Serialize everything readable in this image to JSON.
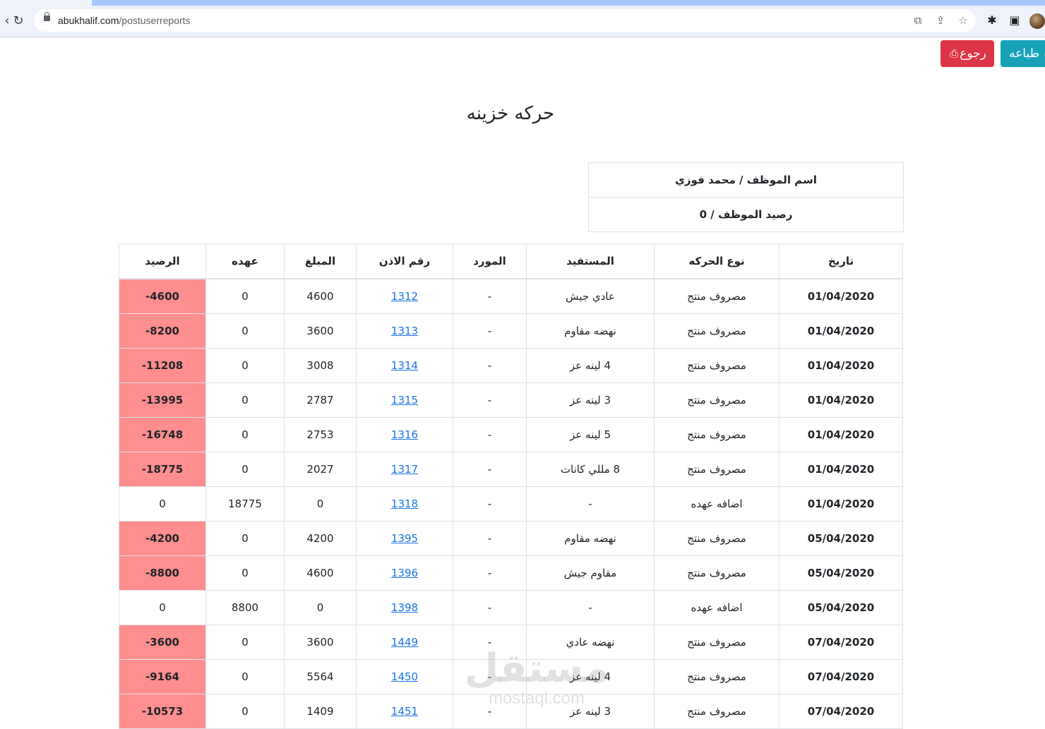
{
  "browser": {
    "url_host": "abukhalif.com",
    "url_path": "/postuserreports"
  },
  "actions": {
    "back_label": "رجوع",
    "print_label": "طباعه"
  },
  "page": {
    "title": "حركه خزينه"
  },
  "employee": {
    "name_line": "اسم الموظف / محمد فوزي",
    "balance_line": "رصيد الموظف / 0"
  },
  "table": {
    "headers": [
      "تاريخ",
      "نوع الحركه",
      "المستفيد",
      "المورد",
      "رقم الاذن",
      "المبلغ",
      "عهده",
      "الرصيد"
    ],
    "rows": [
      {
        "date": "01/04/2020",
        "type": "مصروف منتج",
        "beneficiary": "عادي جيش",
        "supplier": "-",
        "permit_no": "1312",
        "amount": "4600",
        "custody": "0",
        "balance": "-4600",
        "negative": true
      },
      {
        "date": "01/04/2020",
        "type": "مصروف منتج",
        "beneficiary": "نهضه مقاوم",
        "supplier": "-",
        "permit_no": "1313",
        "amount": "3600",
        "custody": "0",
        "balance": "-8200",
        "negative": true
      },
      {
        "date": "01/04/2020",
        "type": "مصروف منتج",
        "beneficiary": "4 لينه عز",
        "supplier": "-",
        "permit_no": "1314",
        "amount": "3008",
        "custody": "0",
        "balance": "-11208",
        "negative": true
      },
      {
        "date": "01/04/2020",
        "type": "مصروف منتج",
        "beneficiary": "3 لينه عز",
        "supplier": "-",
        "permit_no": "1315",
        "amount": "2787",
        "custody": "0",
        "balance": "-13995",
        "negative": true
      },
      {
        "date": "01/04/2020",
        "type": "مصروف منتج",
        "beneficiary": "5 لينه عز",
        "supplier": "-",
        "permit_no": "1316",
        "amount": "2753",
        "custody": "0",
        "balance": "-16748",
        "negative": true
      },
      {
        "date": "01/04/2020",
        "type": "مصروف منتج",
        "beneficiary": "8 مللي كانات",
        "supplier": "-",
        "permit_no": "1317",
        "amount": "2027",
        "custody": "0",
        "balance": "-18775",
        "negative": true
      },
      {
        "date": "01/04/2020",
        "type": "اضافه عهده",
        "beneficiary": "-",
        "supplier": "-",
        "permit_no": "1318",
        "amount": "0",
        "custody": "18775",
        "balance": "0",
        "negative": false
      },
      {
        "date": "05/04/2020",
        "type": "مصروف منتج",
        "beneficiary": "نهضه مقاوم",
        "supplier": "-",
        "permit_no": "1395",
        "amount": "4200",
        "custody": "0",
        "balance": "-4200",
        "negative": true
      },
      {
        "date": "05/04/2020",
        "type": "مصروف منتج",
        "beneficiary": "مقاوم جيش",
        "supplier": "-",
        "permit_no": "1396",
        "amount": "4600",
        "custody": "0",
        "balance": "-8800",
        "negative": true
      },
      {
        "date": "05/04/2020",
        "type": "اضافه عهده",
        "beneficiary": "-",
        "supplier": "-",
        "permit_no": "1398",
        "amount": "0",
        "custody": "8800",
        "balance": "0",
        "negative": false
      },
      {
        "date": "07/04/2020",
        "type": "مصروف منتج",
        "beneficiary": "نهضه عادي",
        "supplier": "-",
        "permit_no": "1449",
        "amount": "3600",
        "custody": "0",
        "balance": "-3600",
        "negative": true
      },
      {
        "date": "07/04/2020",
        "type": "مصروف منتج",
        "beneficiary": "4 لينه عز",
        "supplier": "-",
        "permit_no": "1450",
        "amount": "5564",
        "custody": "0",
        "balance": "-9164",
        "negative": true
      },
      {
        "date": "07/04/2020",
        "type": "مصروف منتج",
        "beneficiary": "3 لينه عز",
        "supplier": "-",
        "permit_no": "1451",
        "amount": "1409",
        "custody": "0",
        "balance": "-10573",
        "negative": true
      }
    ]
  },
  "watermark": {
    "logo": "مستقل",
    "domain": "mostaql.com"
  },
  "colors": {
    "negative_balance_bg": "#ff8e8e",
    "back_button": "#dc3545",
    "print_button": "#17a2b8",
    "link": "#1a73e8"
  }
}
